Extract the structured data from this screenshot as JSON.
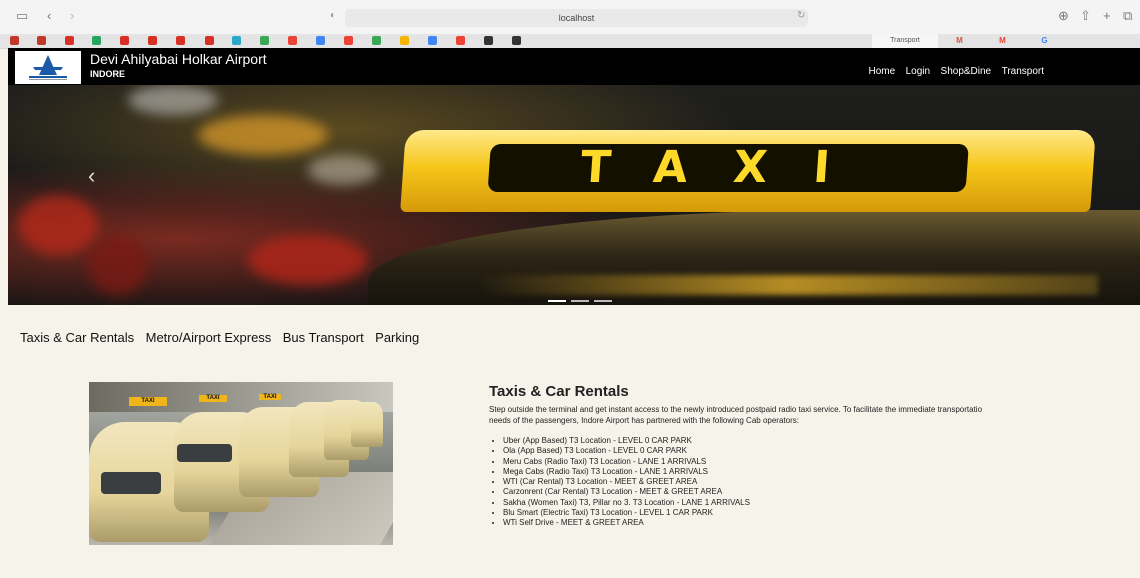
{
  "browser": {
    "address": "localhost",
    "active_tab_title": "Transport",
    "tabs": [
      {
        "icon": "mail-icon",
        "color": "#d9534f",
        "glyph": "M"
      },
      {
        "icon": "gmail-icon",
        "color": "#ea4335",
        "glyph": "M"
      },
      {
        "icon": "google-icon",
        "color": "#4285f4",
        "glyph": "G"
      }
    ]
  },
  "header": {
    "title": "Devi Ahilyabai Holkar Airport",
    "subtitle": "INDORE",
    "nav": [
      "Home",
      "Login",
      "Shop&Dine",
      "Transport"
    ]
  },
  "hero": {
    "sign_text": "TAXI",
    "slides": 3,
    "active_slide": 1
  },
  "section_tabs": [
    "Taxis & Car Rentals",
    "Metro/Airport Express",
    "Bus Transport",
    "Parking"
  ],
  "content": {
    "heading": "Taxis & Car Rentals",
    "intro_line1": "Step outside the terminal and get instant access to the newly introduced postpaid radio taxi service. To facilitate the immediate transportatio",
    "intro_line2": "needs of the passengers, Indore Airport has partnered with the following Cab operators:",
    "operators": [
      "Uber (App Based) T3 Location - LEVEL 0 CAR PARK",
      "Ola (App Based) T3 Location - LEVEL 0 CAR PARK",
      "Meru Cabs (Radio Taxi) T3 Location - LANE 1 ARRIVALS",
      "Mega Cabs (Radio Taxi) T3 Location - LANE 1 ARRIVALS",
      "WTI (Car Rental) T3 Location - MEET & GREET AREA",
      "Carzonrent (Car Rental) T3 Location - MEET & GREET AREA",
      "Sakha (Women Taxi) T3, Pillar no 3. T3 Location - LANE 1 ARRIVALS",
      "Blu Smart (Electric Taxi) T3 Location - LEVEL 1 CAR PARK",
      "WTi Self Drive - MEET & GREET AREA"
    ],
    "photo_sign": "TAXI"
  }
}
